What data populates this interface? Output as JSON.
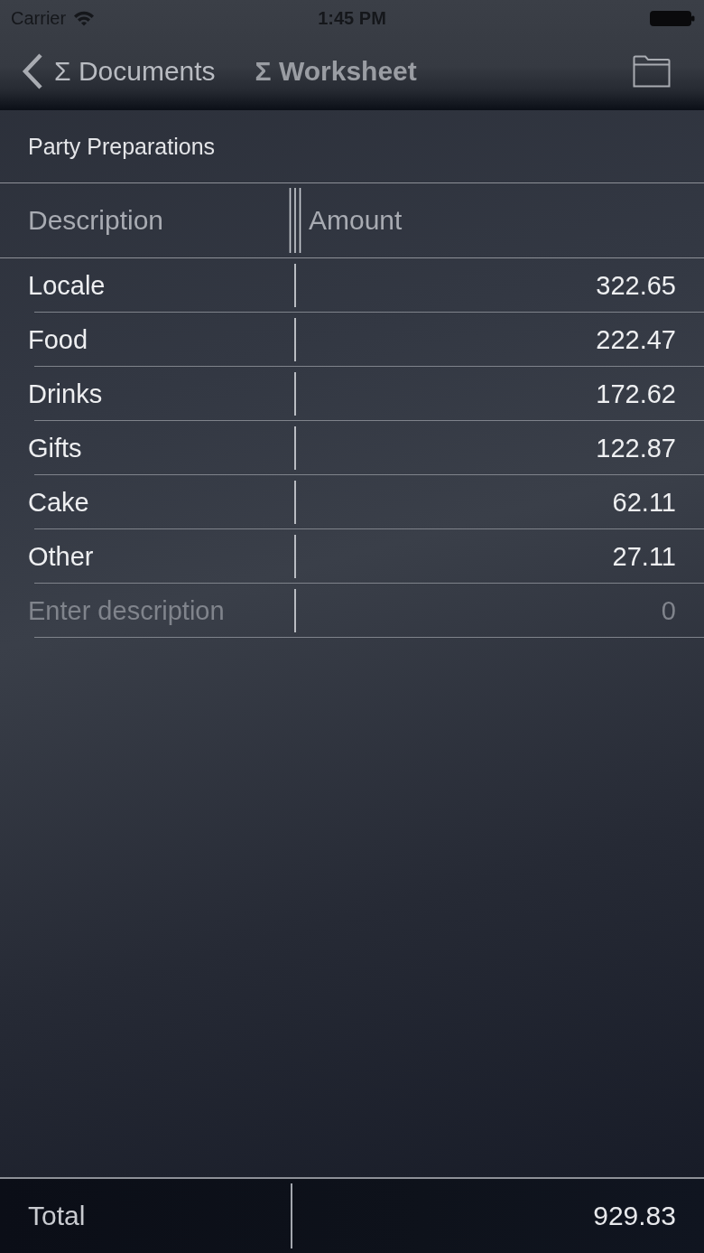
{
  "status_bar": {
    "carrier": "Carrier",
    "time": "1:45 PM"
  },
  "nav": {
    "back_label": "Σ Documents",
    "title": "Σ Worksheet"
  },
  "sheet_title": "Party Preparations",
  "table": {
    "columns": [
      "Description",
      "Amount"
    ],
    "rows": [
      {
        "description": "Locale",
        "amount": "322.65"
      },
      {
        "description": "Food",
        "amount": "222.47"
      },
      {
        "description": "Drinks",
        "amount": "172.62"
      },
      {
        "description": "Gifts",
        "amount": "122.87"
      },
      {
        "description": "Cake",
        "amount": "62.11"
      },
      {
        "description": "Other",
        "amount": "27.11"
      }
    ],
    "new_row": {
      "description_placeholder": "Enter description",
      "amount_placeholder": "0"
    }
  },
  "footer": {
    "label": "Total",
    "value": "929.83"
  }
}
